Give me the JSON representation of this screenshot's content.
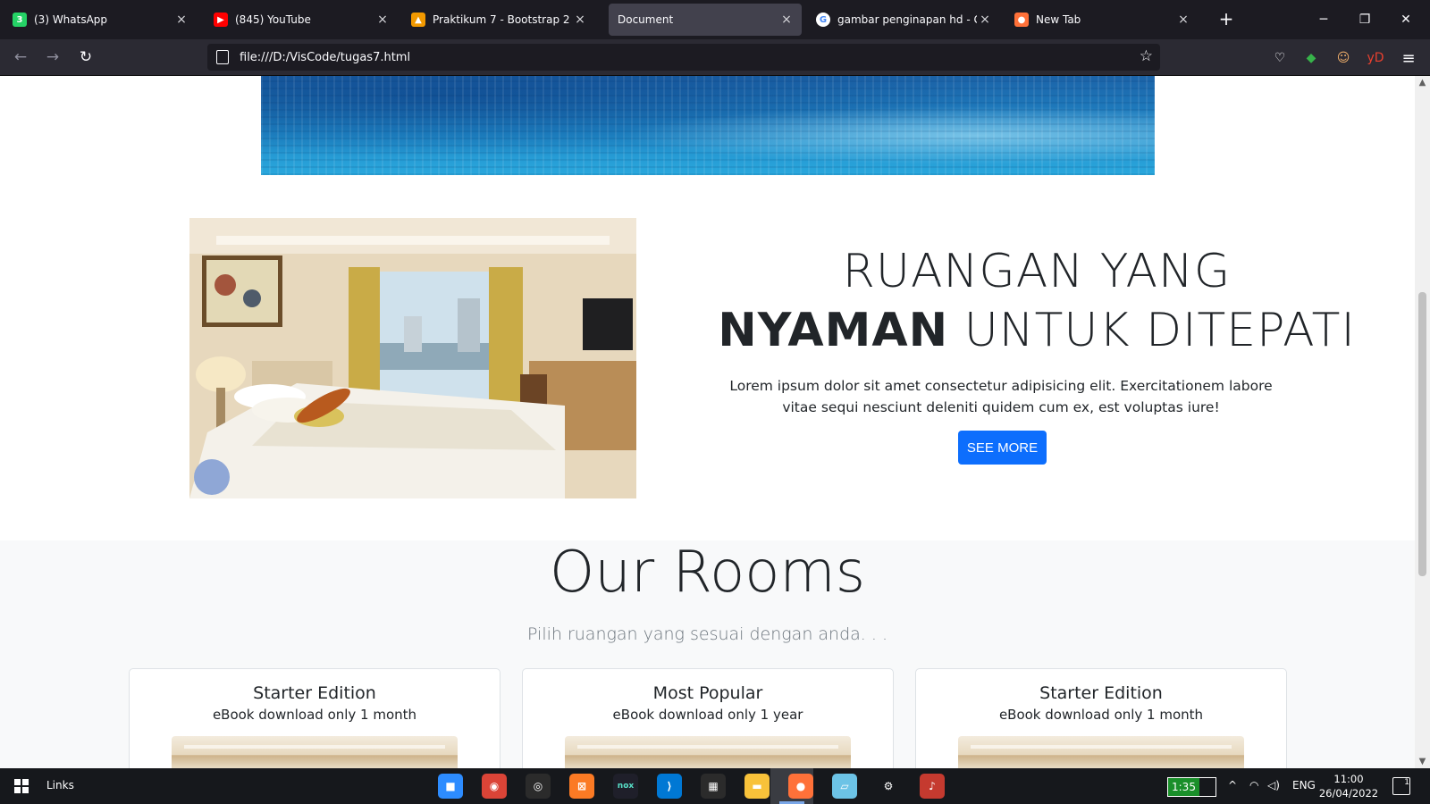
{
  "tabs": [
    {
      "title": "(3) WhatsApp",
      "favicon": "whatsapp-icon",
      "color": "#25d366",
      "glyph": "3",
      "active": false
    },
    {
      "title": "(845) YouTube",
      "favicon": "youtube-icon",
      "color": "#ff0000",
      "glyph": "▶",
      "active": false
    },
    {
      "title": "Praktikum 7 - Bootstrap 2",
      "favicon": "classroom-icon",
      "color": "#f29900",
      "glyph": "▲",
      "active": false
    },
    {
      "title": "Document",
      "favicon": "",
      "color": "",
      "glyph": "",
      "active": true
    },
    {
      "title": "gambar penginapan hd - Googl",
      "favicon": "google-icon",
      "color": "#ffffff",
      "glyph": "G",
      "active": false
    },
    {
      "title": "New Tab",
      "favicon": "firefox-icon",
      "color": "#ff7139",
      "glyph": "●",
      "active": false
    }
  ],
  "browser": {
    "url": "file:///D:/VisCode/tugas7.html",
    "close_glyph": "×",
    "new_tab_glyph": "+",
    "back_glyph": "←",
    "forward_glyph": "→",
    "reload_glyph": "↻",
    "star_glyph": "☆",
    "minimize_glyph": "─",
    "restore_glyph": "❐",
    "window_close_glyph": "✕",
    "menu_glyph": "≡",
    "extensions": [
      {
        "name": "pocket-icon",
        "glyph": "♡",
        "color": "#fbfbfe"
      },
      {
        "name": "extension-colorful-icon",
        "glyph": "◆",
        "color": "#37b34a"
      },
      {
        "name": "profile-avatar-icon",
        "glyph": "☺",
        "color": "#f2b06b"
      },
      {
        "name": "yandex-extension-icon",
        "glyph": "yD",
        "color": "#e8402f"
      }
    ]
  },
  "page": {
    "headline_line1": "RUANGAN YANG",
    "headline_bold": "NYAMAN",
    "headline_rest": " UNTUK DITEPATI",
    "lead": "Lorem ipsum dolor sit amet consectetur adipisicing elit. Exercitationem labore vitae sequi nesciunt deleniti quidem cum ex, est voluptas iure!",
    "button": "SEE MORE",
    "rooms_title": "Our Rooms",
    "rooms_subtitle": "Pilih ruangan yang sesuai dengan anda. . .",
    "cards": [
      {
        "title": "Starter Edition",
        "text": "eBook download only 1 month"
      },
      {
        "title": "Most Popular",
        "text": "eBook download only 1 year"
      },
      {
        "title": "Starter Edition",
        "text": "eBook download only 1 month"
      }
    ],
    "accent_color": "#0d6efd"
  },
  "taskbar": {
    "links_label": "Links",
    "apps": [
      {
        "name": "zoom-icon",
        "color": "#2d8cff",
        "glyph": "■"
      },
      {
        "name": "chrome-icon",
        "color": "#db4437",
        "glyph": "◉"
      },
      {
        "name": "obs-icon",
        "color": "#2b2b2b",
        "glyph": "◎"
      },
      {
        "name": "xampp-icon",
        "color": "#fb7a24",
        "glyph": "⊠"
      },
      {
        "name": "nox-icon",
        "color": "#1f1f2a",
        "glyph": "nox"
      },
      {
        "name": "vscode-icon",
        "color": "#0078d4",
        "glyph": "⟩"
      },
      {
        "name": "clapper-icon",
        "color": "#2b2b2b",
        "glyph": "▦"
      },
      {
        "name": "file-explorer-icon",
        "color": "#f8c23a",
        "glyph": "▬"
      },
      {
        "name": "firefox-taskbar-icon",
        "color": "#ff7139",
        "glyph": "●"
      },
      {
        "name": "notes-icon",
        "color": "#6cc3e6",
        "glyph": "▱"
      },
      {
        "name": "settings-icon",
        "color": "#16181c",
        "glyph": "⚙"
      },
      {
        "name": "app-icon",
        "color": "#c53a2f",
        "glyph": "♪"
      }
    ],
    "battery": "1:35",
    "chevron": "^",
    "language": "ENG",
    "time": "11:00",
    "date": "26/04/2022",
    "notification_count": "1"
  }
}
